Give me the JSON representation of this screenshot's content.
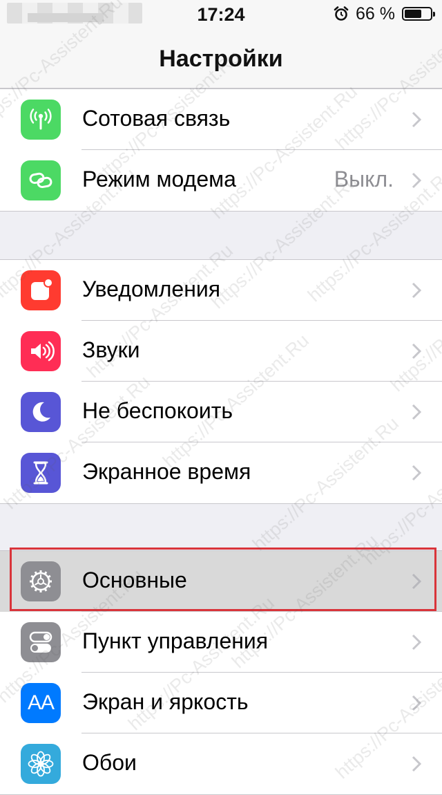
{
  "status_bar": {
    "time": "17:24",
    "battery_percent": "66 %",
    "battery_level": 0.66
  },
  "nav": {
    "title": "Настройки"
  },
  "groups": [
    {
      "items": [
        {
          "label": "Сотовая связь",
          "value": "",
          "icon": "antenna-icon",
          "color": "#4cd964"
        },
        {
          "label": "Режим модема",
          "value": "Выкл.",
          "icon": "chain-link-icon",
          "color": "#4cd964"
        }
      ]
    },
    {
      "items": [
        {
          "label": "Уведомления",
          "icon": "notifications-icon",
          "color": "#ff3b30"
        },
        {
          "label": "Звуки",
          "icon": "speaker-icon",
          "color": "#ff2d55"
        },
        {
          "label": "Не беспокоить",
          "icon": "moon-icon",
          "color": "#5856d6"
        },
        {
          "label": "Экранное время",
          "icon": "hourglass-icon",
          "color": "#5856d6"
        }
      ]
    },
    {
      "items": [
        {
          "label": "Основные",
          "icon": "gear-icon",
          "color": "#8e8e93",
          "selected": true
        },
        {
          "label": "Пункт управления",
          "icon": "toggles-icon",
          "color": "#8e8e93"
        },
        {
          "label": "Экран и яркость",
          "icon": "text-size-icon",
          "color": "#007aff",
          "glyph": "AA"
        },
        {
          "label": "Обои",
          "icon": "flower-icon",
          "color": "#34aadc"
        }
      ]
    }
  ],
  "watermark": "https://Pc-Assistent.Ru",
  "highlight_color": "#d9343a"
}
